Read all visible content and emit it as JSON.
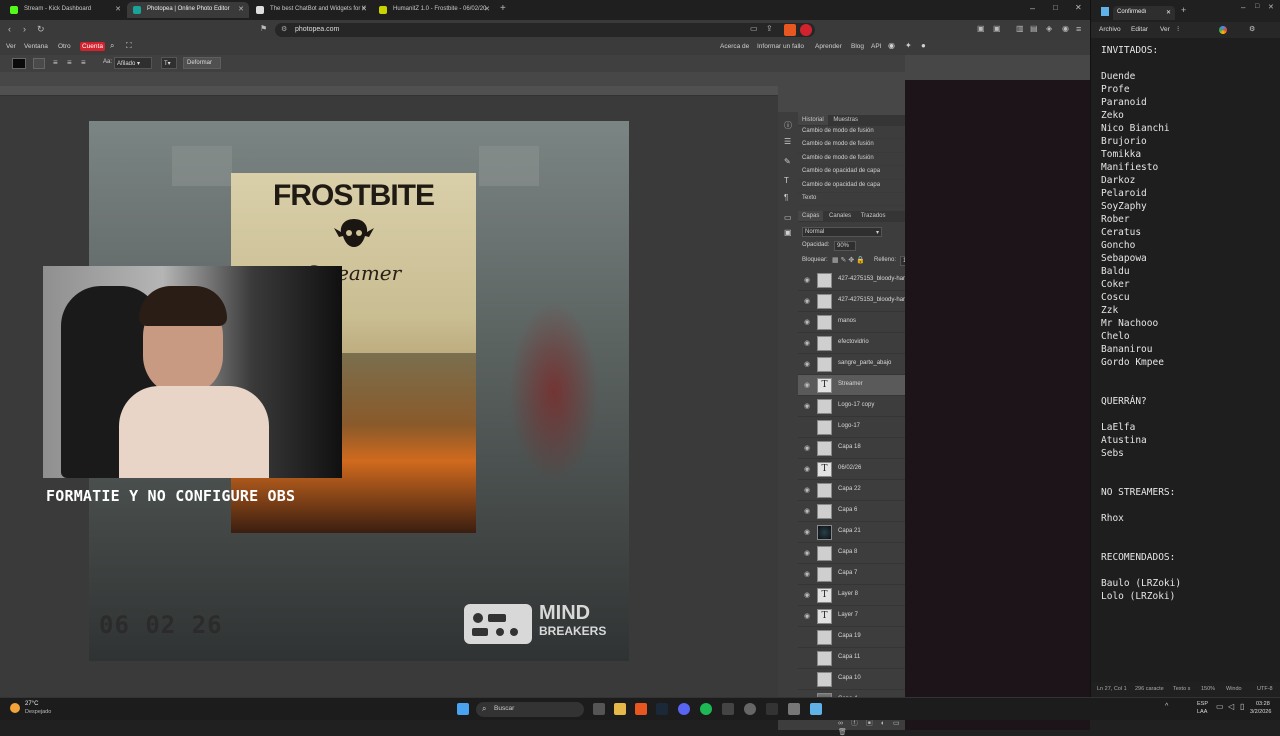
{
  "browser": {
    "tabs": [
      {
        "title": "Stream - Kick Dashboard",
        "color": "#53fc18",
        "active": false
      },
      {
        "title": "Photopea | Online Photo Editor",
        "color": "#18a497",
        "active": true
      },
      {
        "title": "The best ChatBot and Widgets for K",
        "color": "#dddddd",
        "active": false
      },
      {
        "title": "HumanitZ 1.0 - Frostbite - 06/02/20",
        "color": "#c8d400",
        "active": false
      }
    ],
    "new_tab": "+",
    "url": "photopea.com"
  },
  "photopea": {
    "menu": [
      "Ver",
      "Ventana",
      "Otro"
    ],
    "menu_highlight": "Cuenta",
    "menu_right": [
      "Acerca de",
      "Informar un fallo",
      "Aprender",
      "Blog",
      "API"
    ],
    "options": {
      "aa_label": "Aa:",
      "aa_value": "Afilado",
      "deform_button": "Deformar",
      "t_value": "T"
    },
    "history_tabs": [
      "Historial",
      "Muestras"
    ],
    "history": [
      "Cambio de modo de fusión",
      "Cambio de modo de fusión",
      "Cambio de modo de fusión",
      "Cambio de opacidad de capa",
      "Cambio de opacidad de capa",
      "Texto"
    ],
    "layer_tabs": [
      "Capas",
      "Canales",
      "Trazados"
    ],
    "blend_mode": "Normal",
    "opacity_label": "Opacidad:",
    "opacity_value": "90%",
    "lock_label": "Bloquear:",
    "fill_label": "Relleno:",
    "fill_value": "100%",
    "layers": [
      {
        "name": "427-4275153_bloody-har",
        "type": "img",
        "visible": true,
        "fx": false
      },
      {
        "name": "427-4275153_bloody-har",
        "type": "img",
        "visible": true,
        "fx": false
      },
      {
        "name": "manos",
        "type": "img",
        "visible": true,
        "fx": false
      },
      {
        "name": "efectovidrio",
        "type": "img",
        "visible": true,
        "fx": false
      },
      {
        "name": "sangre_parte_abajo",
        "type": "img",
        "visible": true,
        "fx": false
      },
      {
        "name": "Streamer",
        "type": "text",
        "visible": true,
        "fx": false,
        "selected": true
      },
      {
        "name": "Logo-17 copy",
        "type": "img",
        "visible": true,
        "fx": true
      },
      {
        "name": "Logo-17",
        "type": "img",
        "visible": false,
        "fx": false
      },
      {
        "name": "Capa 18",
        "type": "img",
        "visible": true,
        "fx": false
      },
      {
        "name": "06/02/26",
        "type": "text",
        "visible": true,
        "fx": true
      },
      {
        "name": "Capa 22",
        "type": "img",
        "visible": true,
        "fx": false
      },
      {
        "name": "Capa 6",
        "type": "img",
        "visible": true,
        "fx": false
      },
      {
        "name": "Capa 21",
        "type": "dark",
        "visible": true,
        "fx": false
      },
      {
        "name": "Capa 8",
        "type": "img",
        "visible": true,
        "fx": false
      },
      {
        "name": "Capa 7",
        "type": "img",
        "visible": true,
        "fx": false
      },
      {
        "name": "Layer 8",
        "type": "text",
        "visible": true,
        "fx": false
      },
      {
        "name": "Layer 7",
        "type": "text",
        "visible": true,
        "fx": false
      },
      {
        "name": "Capa 19",
        "type": "img",
        "visible": false,
        "fx": true
      },
      {
        "name": "Capa 11",
        "type": "img",
        "visible": false,
        "fx": true
      },
      {
        "name": "Capa 10",
        "type": "img",
        "visible": false,
        "fx": false
      },
      {
        "name": "Capa 4",
        "type": "photo",
        "visible": true,
        "fx": false
      }
    ],
    "fx_label": "eff",
    "poster": {
      "title": "FROSTBITE",
      "subtitle": "Streamer",
      "date": "06 02 26",
      "brand_top": "MIND",
      "brand_bottom": "BREAKERS"
    }
  },
  "overlay": {
    "caption": "FORMATIE Y NO CONFIGURE OBS"
  },
  "notepad": {
    "title": "Confirmedı",
    "menu": [
      "Archivo",
      "Editar",
      "Ver"
    ],
    "content": "INVITADOS:\n\nDuende\nProfe\nParanoid\nZeko\nNico Bianchi\nBrujorio\nTomikka\nManifiesto\nDarkoz\nPelaroid\nSoyZaphy\nRober\nCeratus\nGoncho\nSebapowa\nBaldu\nCoker\nCoscu\nZzk\nMr Nachooo\nChelo\nBananirou\nGordo Kmpee\n\n\nQUERRÁN?\n\nLaElfa\nAtustina\nSebs\n\n\nNO STREAMERS:\n\nRhox\n\n\nRECOMENDADOS:\n\nBaulo (LRZoki)\nLolo (LRZoki)",
    "status": {
      "pos": "Ln 27, Col 1",
      "chars": "296 caracte",
      "format": "Texto s",
      "zoom": "150%",
      "eol": "Windo",
      "enc": "UTF-8"
    }
  },
  "taskbar": {
    "temp": "27°C",
    "weather": "Despejado",
    "search": "Buscar",
    "lang": "ESP",
    "lang2": "LAA",
    "time": "03:28",
    "date": "3/2/2026"
  }
}
